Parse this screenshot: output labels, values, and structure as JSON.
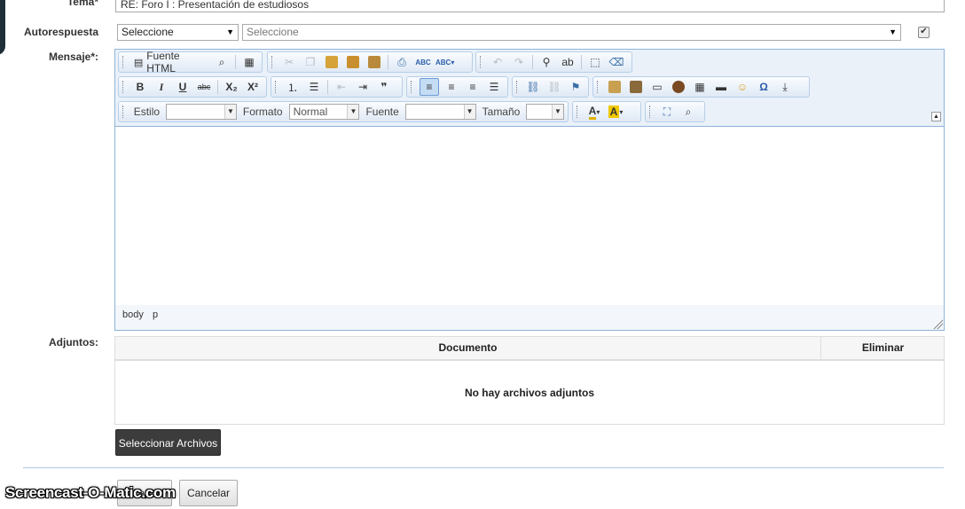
{
  "form": {
    "topic_label": "Tema*",
    "topic_value": "RE: Foro I : Presentación de estudiosos",
    "autoreply_label": "Autorespuesta",
    "autoreply_select": "Seleccione",
    "autoreply_select2": "Seleccione",
    "autoreply_checked": true,
    "message_label": "Mensaje*:",
    "attachments_label": "Adjuntos:"
  },
  "editor": {
    "source_button": "Fuente HTML",
    "style_label": "Estilo",
    "style_value": "",
    "format_label": "Formato",
    "format_value": "Normal",
    "font_label": "Fuente",
    "font_value": "",
    "size_label": "Tamaño",
    "size_value": "",
    "path": [
      "body",
      "p"
    ],
    "icons": {
      "bold": "B",
      "italic": "I",
      "underline": "U",
      "strike": "abc",
      "subscript": "X₂",
      "superscript": "X²",
      "ordered_list": "⒈",
      "bullet_list": "☰",
      "blockquote": "❞",
      "omega": "Ω"
    }
  },
  "attachments": {
    "col_document": "Documento",
    "col_delete": "Eliminar",
    "empty_text": "No hay archivos adjuntos",
    "select_button": "Seleccionar Archivos"
  },
  "actions": {
    "accept": "Aceptar",
    "cancel": "Cancelar"
  },
  "watermark": "Screencast-O-Matic.com",
  "colors": {
    "editor_border": "#8fb3d9",
    "toolbar_bg": "#eaf1f9",
    "dark_button": "#3c3c3c",
    "divider": "#aac8e8"
  }
}
